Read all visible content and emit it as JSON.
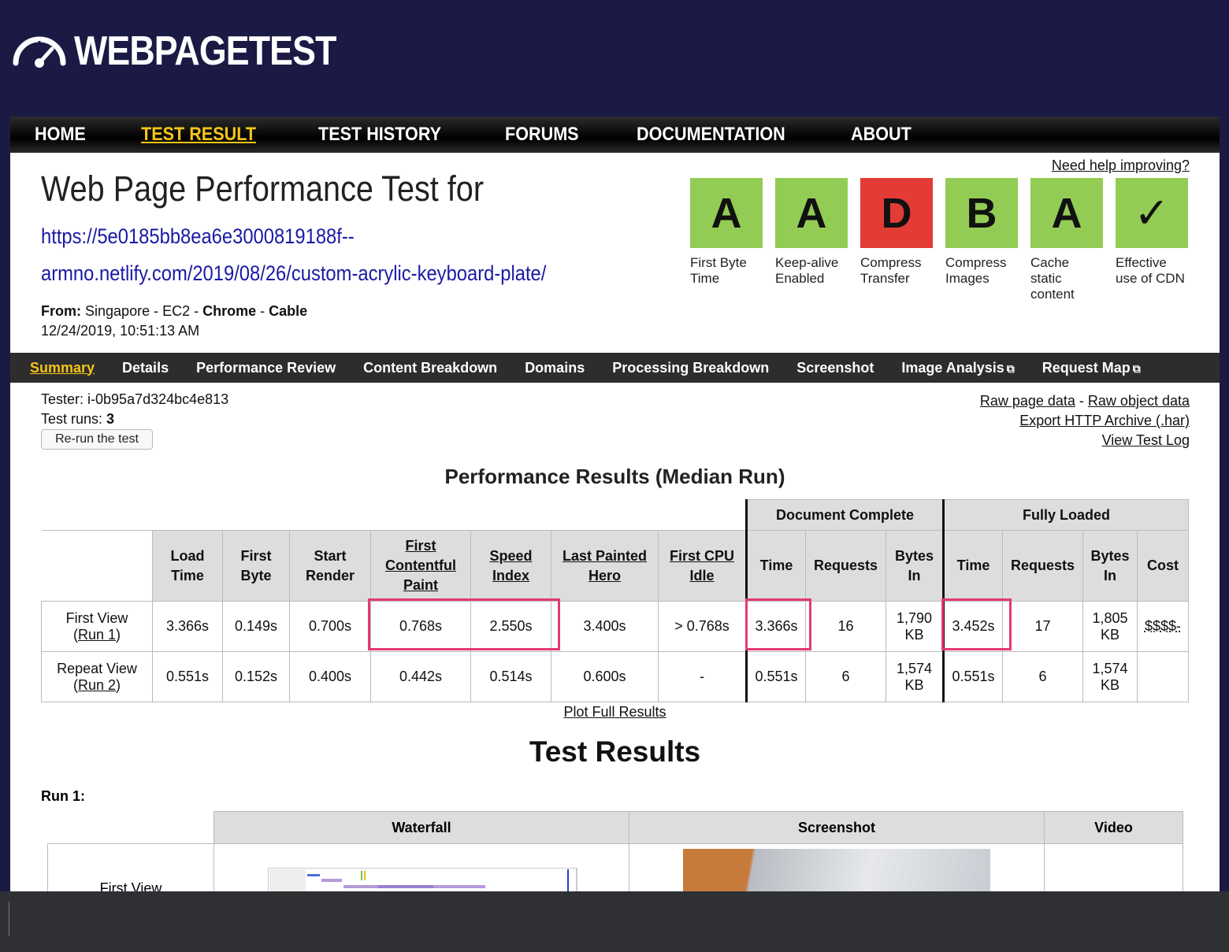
{
  "logo": {
    "text": "WEBPAGETEST",
    "icon": "speedometer-icon"
  },
  "topnav": [
    {
      "label": "HOME",
      "active": false
    },
    {
      "label": "TEST RESULT",
      "active": true
    },
    {
      "label": "TEST HISTORY",
      "active": false
    },
    {
      "label": "FORUMS",
      "active": false
    },
    {
      "label": "DOCUMENTATION",
      "active": false
    },
    {
      "label": "ABOUT",
      "active": false
    }
  ],
  "header": {
    "title": "Web Page Performance Test for",
    "url": "https://5e0185bb8ea6e3000819188f--armno.netlify.com/2019/08/26/custom-acrylic-keyboard-plate/",
    "from_label": "From:",
    "from_location": "Singapore - EC2 - ",
    "from_browser": "Chrome",
    "from_sep": " - ",
    "from_connection": "Cable",
    "date": "12/24/2019, 10:51:13 AM",
    "help": "Need help improving?"
  },
  "grades": [
    {
      "grade": "A",
      "label": "First Byte Time",
      "color": "#93cc55"
    },
    {
      "grade": "A",
      "label": "Keep-alive Enabled",
      "color": "#93cc55"
    },
    {
      "grade": "D",
      "label": "Compress Transfer",
      "color": "#e33b36"
    },
    {
      "grade": "B",
      "label": "Compress Images",
      "color": "#93cc55"
    },
    {
      "grade": "A",
      "label": "Cache static content",
      "color": "#93cc55"
    },
    {
      "grade": "✓",
      "label": "Effective use of CDN",
      "color": "#93cc55"
    }
  ],
  "subnav": [
    {
      "label": "Summary",
      "active": true
    },
    {
      "label": "Details"
    },
    {
      "label": "Performance Review"
    },
    {
      "label": "Content Breakdown"
    },
    {
      "label": "Domains"
    },
    {
      "label": "Processing Breakdown"
    },
    {
      "label": "Screenshot"
    },
    {
      "label": "Image Analysis",
      "external": true
    },
    {
      "label": "Request Map",
      "external": true
    }
  ],
  "info": {
    "tester_label": "Tester: ",
    "tester": "i-0b95a7d324bc4e813",
    "runs_label": "Test runs: ",
    "runs": "3",
    "rerun": "Re-run the test",
    "raw_page": "Raw page data",
    "raw_sep": " - ",
    "raw_object": "Raw object data",
    "export_har": "Export HTTP Archive (.har)",
    "test_log": "View Test Log"
  },
  "perf": {
    "heading": "Performance Results (Median Run)",
    "group_doc": "Document Complete",
    "group_full": "Fully Loaded",
    "headers": {
      "load": [
        "Load",
        "Time"
      ],
      "first_byte": [
        "First",
        "Byte"
      ],
      "start_render": [
        "Start",
        "Render"
      ],
      "fcp": [
        "First",
        "Contentful",
        "Paint"
      ],
      "speed_index": [
        "Speed",
        "Index"
      ],
      "lph": [
        "Last Painted",
        "Hero"
      ],
      "cpu_idle": [
        "First CPU",
        "Idle"
      ],
      "doc_time": "Time",
      "doc_requests": "Requests",
      "doc_bytes": [
        "Bytes",
        "In"
      ],
      "full_time": "Time",
      "full_requests": "Requests",
      "full_bytes": [
        "Bytes",
        "In"
      ],
      "cost": "Cost"
    },
    "rows": [
      {
        "label": "First View",
        "run": "Run 1",
        "load": "3.366s",
        "first_byte": "0.149s",
        "start_render": "0.700s",
        "fcp": "0.768s",
        "speed_index": "2.550s",
        "lph": "3.400s",
        "cpu_idle": "> 0.768s",
        "doc_time": "3.366s",
        "doc_requests": "16",
        "doc_bytes": [
          "1,790",
          "KB"
        ],
        "full_time": "3.452s",
        "full_requests": "17",
        "full_bytes": [
          "1,805",
          "KB"
        ],
        "cost": "$$$$-"
      },
      {
        "label": "Repeat View",
        "run": "Run 2",
        "load": "0.551s",
        "first_byte": "0.152s",
        "start_render": "0.400s",
        "fcp": "0.442s",
        "speed_index": "0.514s",
        "lph": "0.600s",
        "cpu_idle": "-",
        "doc_time": "0.551s",
        "doc_requests": "6",
        "doc_bytes": [
          "1,574",
          "KB"
        ],
        "full_time": "0.551s",
        "full_requests": "6",
        "full_bytes": [
          "1,574",
          "KB"
        ],
        "cost": ""
      }
    ],
    "plot_link": "Plot Full Results"
  },
  "results": {
    "heading": "Test Results",
    "run_label": "Run 1:",
    "columns": [
      "Waterfall",
      "Screenshot",
      "Video"
    ],
    "first_view": "First View"
  },
  "colors": {
    "highlight": "#e33a6e",
    "nav_active": "#f5c518",
    "link": "#1a1aa6",
    "header_bg": "#1b1a45"
  }
}
